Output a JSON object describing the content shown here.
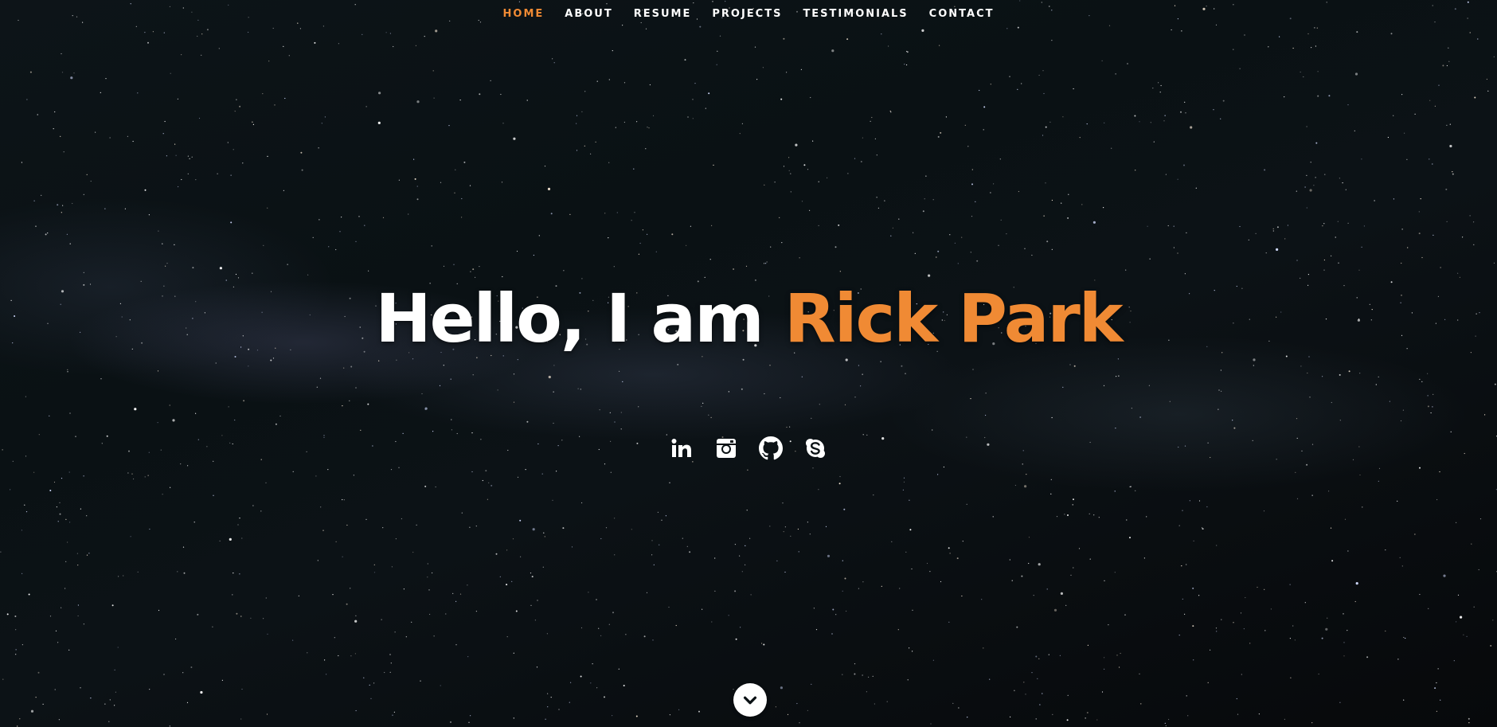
{
  "nav": {
    "items": [
      {
        "label": "HOME",
        "active": true
      },
      {
        "label": "ABOUT",
        "active": false
      },
      {
        "label": "RESUME",
        "active": false
      },
      {
        "label": "PROJECTS",
        "active": false
      },
      {
        "label": "TESTIMONIALS",
        "active": false
      },
      {
        "label": "CONTACT",
        "active": false
      }
    ]
  },
  "hero": {
    "greeting": "Hello, I am ",
    "name": "Rick Park"
  },
  "social": {
    "icons": [
      "linkedin-icon",
      "instagram-icon",
      "github-icon",
      "skype-icon"
    ]
  },
  "scroll_down": {
    "icon": "chevron-down-icon"
  },
  "colors": {
    "accent": "#f08a34",
    "text": "#ffffff",
    "background": "#0a1114"
  }
}
